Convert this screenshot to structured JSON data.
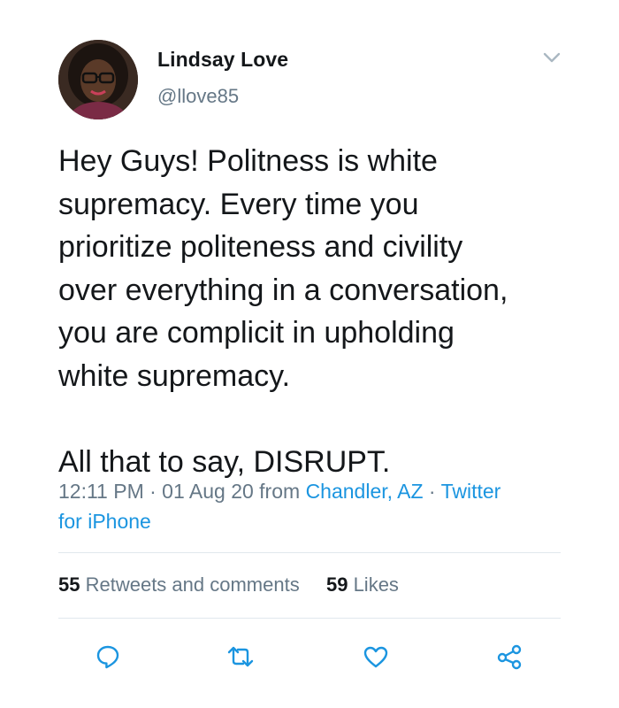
{
  "user": {
    "display_name": "Lindsay Love",
    "handle": "@llove85"
  },
  "tweet": {
    "lines": [
      "Hey Guys! Politness is white",
      "supremacy. Every time you",
      "prioritize politeness and civility",
      "over everything in a conversation,",
      "you are complicit in upholding",
      "white supremacy.",
      "",
      "All that to say, DISRUPT."
    ]
  },
  "meta": {
    "time_date": "12:11 PM · 01 Aug 20 from ",
    "location": "Chandler, AZ",
    "separator": " · ",
    "source_line1": "Twitter",
    "source_line2": "for iPhone"
  },
  "stats": {
    "retweets_count": "55",
    "retweets_label": " Retweets and comments",
    "likes_count": "59",
    "likes_label": " Likes"
  },
  "icons": {
    "chevron": "chevron-down-icon",
    "reply": "reply-icon",
    "retweet": "retweet-icon",
    "like": "heart-icon",
    "share": "share-icon"
  },
  "colors": {
    "text": "#14171a",
    "secondary": "#657786",
    "link": "#1b95e0",
    "divider": "#e1e8ed",
    "icon": "#1b95e0"
  }
}
